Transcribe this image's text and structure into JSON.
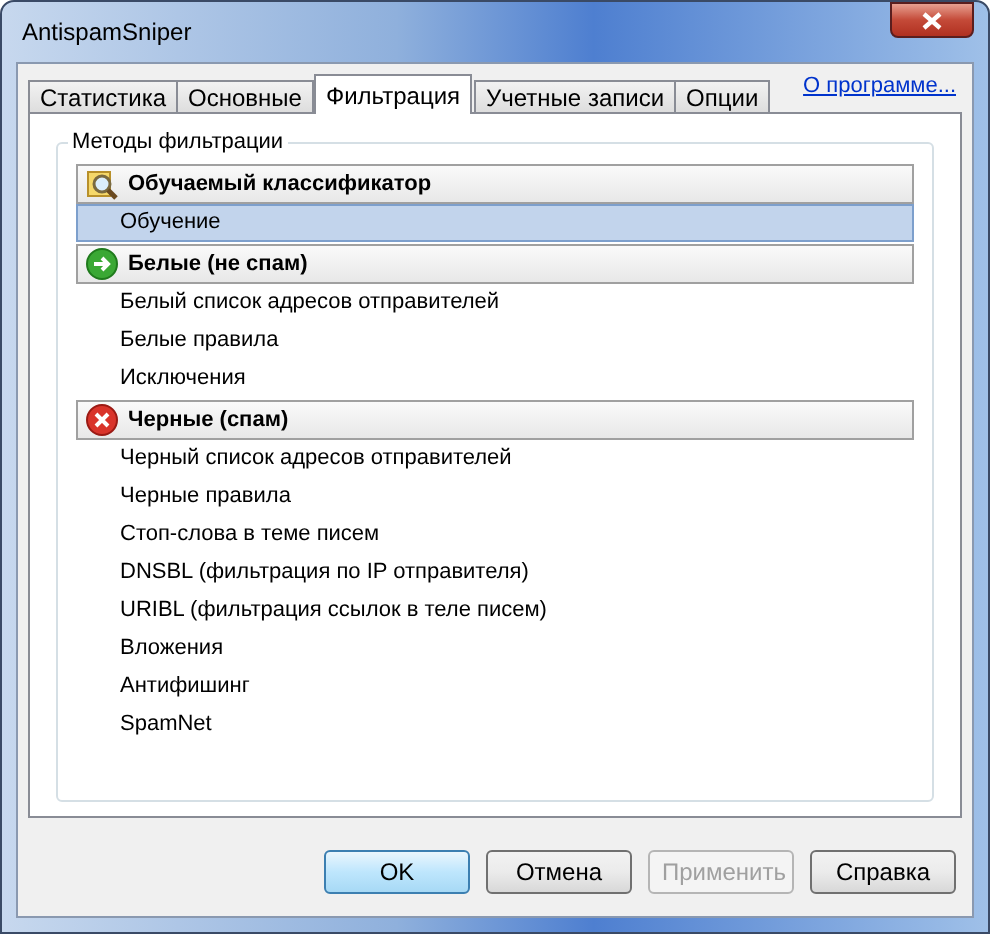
{
  "window": {
    "title": "AntispamSniper"
  },
  "tabs": [
    {
      "label": "Статистика",
      "selected": false
    },
    {
      "label": "Основные",
      "selected": false
    },
    {
      "label": "Фильтрация",
      "selected": true
    },
    {
      "label": "Учетные записи",
      "selected": false
    },
    {
      "label": "Опции",
      "selected": false
    }
  ],
  "about_link": "О программе...",
  "group": {
    "title": "Методы фильтрации",
    "sections": [
      {
        "title": "Обучаемый классификатор",
        "kind": "classifier",
        "items": [
          {
            "label": "Обучение",
            "selected": true
          }
        ]
      },
      {
        "title": "Белые (не спам)",
        "kind": "allow",
        "items": [
          {
            "label": "Белый список адресов отправителей",
            "selected": false
          },
          {
            "label": "Белые правила",
            "selected": false
          },
          {
            "label": "Исключения",
            "selected": false
          }
        ]
      },
      {
        "title": "Черные (спам)",
        "kind": "deny",
        "items": [
          {
            "label": "Черный список адресов отправителей",
            "selected": false
          },
          {
            "label": "Черные правила",
            "selected": false
          },
          {
            "label": "Стоп-слова в теме писем",
            "selected": false
          },
          {
            "label": "DNSBL (фильтрация по IP отправителя)",
            "selected": false
          },
          {
            "label": "URIBL (фильтрация ссылок в теле писем)",
            "selected": false
          },
          {
            "label": "Вложения",
            "selected": false
          },
          {
            "label": "Антифишинг",
            "selected": false
          },
          {
            "label": "SpamNet",
            "selected": false
          }
        ]
      }
    ]
  },
  "buttons": [
    {
      "label": "OK",
      "default": true,
      "disabled": false
    },
    {
      "label": "Отмена",
      "default": false,
      "disabled": false
    },
    {
      "label": "Применить",
      "default": false,
      "disabled": true
    },
    {
      "label": "Справка",
      "default": false,
      "disabled": false
    }
  ]
}
